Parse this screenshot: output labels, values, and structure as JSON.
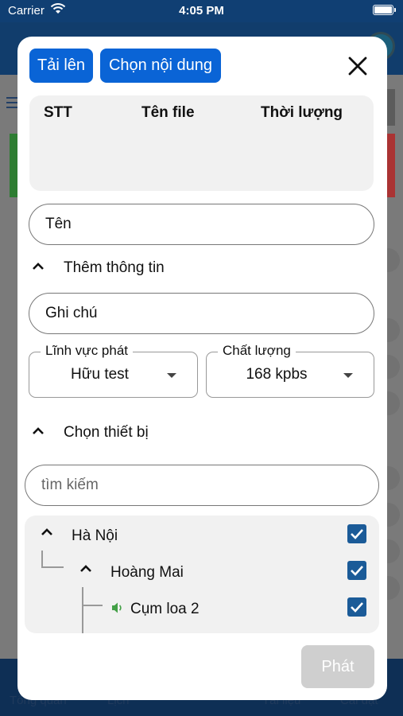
{
  "status_bar": {
    "carrier": "Carrier",
    "time": "4:05 PM"
  },
  "background": {
    "bottom_tabs": [
      "Tổng quan",
      "Lịch",
      "Tài liệu",
      "Cài đặt"
    ]
  },
  "modal": {
    "upload_label": "Tải lên",
    "choose_content_label": "Chọn nội dung",
    "table": {
      "columns": [
        "STT",
        "Tên file",
        "Thời lượng"
      ],
      "rows": []
    },
    "name_field": {
      "placeholder": "Tên",
      "value": ""
    },
    "more_info_label": "Thêm thông tin",
    "note_field": {
      "placeholder": "Ghi chú",
      "value": ""
    },
    "field_select": {
      "label": "Lĩnh vực phát",
      "value": "Hữu test"
    },
    "quality_select": {
      "label": "Chất lượng",
      "value": "168 kpbs"
    },
    "device_section_label": "Chọn thiết bị",
    "search_field": {
      "placeholder": "tìm kiếm"
    },
    "device_tree": [
      {
        "label": "Hà Nội",
        "checked": true
      },
      {
        "label": "Hoàng Mai",
        "checked": true
      },
      {
        "label": "Cụm loa 2",
        "checked": true
      }
    ],
    "play_label": "Phát"
  },
  "colors": {
    "primary": "#0a64d6",
    "header": "#113d6c",
    "checkbox": "#1b5b98",
    "disabled": "#cfcfcf",
    "speaker": "#43a047"
  }
}
